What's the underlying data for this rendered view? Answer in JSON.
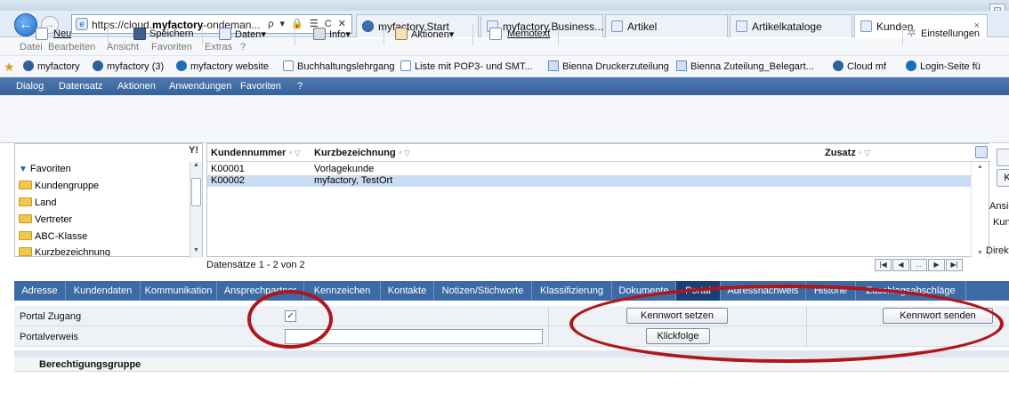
{
  "browser": {
    "url_prefix": "https://cloud.",
    "url_bold": "myfactory",
    "url_suffix": "-ondeman...",
    "url_tools": "ρ ▾ 🔒 ☰ C ✕",
    "minimize": "▭",
    "back": "←",
    "forward": "→",
    "tabs": [
      {
        "label": "myfactory.Start"
      },
      {
        "label": "myfactory.Business..."
      },
      {
        "label": "Artikel"
      },
      {
        "label": "Artikelkataloge"
      },
      {
        "label": "Kunden"
      }
    ],
    "tab_close": "×"
  },
  "ie_menu": [
    "Datei",
    "Bearbeiten",
    "Ansicht",
    "Favoriten",
    "Extras",
    "?"
  ],
  "favorites": [
    {
      "label": "myfactory",
      "icon": "myfactory-icon"
    },
    {
      "label": "myfactory (3)",
      "icon": "myfactory-icon"
    },
    {
      "label": "myfactory website",
      "icon": "website-icon"
    },
    {
      "label": "Buchhaltungslehrgang",
      "icon": "ie-page-icon"
    },
    {
      "label": "Liste mit POP3- und SMT...",
      "icon": "ie-page-icon"
    },
    {
      "label": "Bienna Druckerzuteilung",
      "icon": "page-icon"
    },
    {
      "label": "Bienna Zuteilung_Belegart...",
      "icon": "page-icon"
    },
    {
      "label": "Cloud mf",
      "icon": "myfactory-icon"
    },
    {
      "label": "Login-Seite fü",
      "icon": "website-icon"
    }
  ],
  "app_menu": [
    "Dialog",
    "Datensatz",
    "Aktionen",
    "Anwendungen",
    "Favoriten",
    "?"
  ],
  "toolbar": {
    "new": "Neu",
    "save": "Speichern",
    "data": "Daten▾",
    "info": "Info▾",
    "actions": "Aktionen▾",
    "memo": "Memotext",
    "settings": "Einstellungen"
  },
  "tree": {
    "filter_symbol": "Y!",
    "items": [
      "Favoriten",
      "Kundengruppe",
      "Land",
      "Vertreter",
      "ABC-Klasse",
      "Kurzbezeichnung"
    ]
  },
  "grid": {
    "columns": [
      "Kundennummer",
      "Kurzbezeichnung",
      "Zusatz"
    ],
    "sort_symbol": "⁴ ▽",
    "rows": [
      {
        "nr": "K00001",
        "name": "Vorlagekunde",
        "zusatz": ""
      },
      {
        "nr": "K00002",
        "name": "myfactory, TestOrt",
        "zusatz": ""
      }
    ],
    "count_text": "Datensätze 1 - 2 von 2",
    "pager": [
      "|◀",
      "◀",
      "...",
      "▶",
      "▶|"
    ]
  },
  "right_panel": {
    "ansicht": "Ansic",
    "kund": "Kund",
    "direkt": "Direkt",
    "btn_k": "K"
  },
  "detail_tabs": [
    "Adresse",
    "Kundendaten",
    "Kommunikation",
    "Ansprechpartner",
    "Kennzeichen",
    "Kontakte",
    "Notizen/Stichworte",
    "Klassifizierung",
    "Dokumente",
    "Portal",
    "Adressnachweis",
    "Historie",
    "Zuschlagsabschläge"
  ],
  "portal": {
    "access_label": "Portal Zugang",
    "access_checked": "✓",
    "link_label": "Portalverweis",
    "link_value": "",
    "set_password": "Kennwort setzen",
    "send_password": "Kennwort senden",
    "click_sequence": "Klickfolge",
    "perm_header": "Berechtigungsgruppe"
  },
  "colors": {
    "app_menu_bg": "#3a669f",
    "tab_bar_bg": "#3c6aa5",
    "active_tab_bg": "#1a3f75",
    "selected_row": "#c9dcf2",
    "annotation": "#b0151a"
  }
}
